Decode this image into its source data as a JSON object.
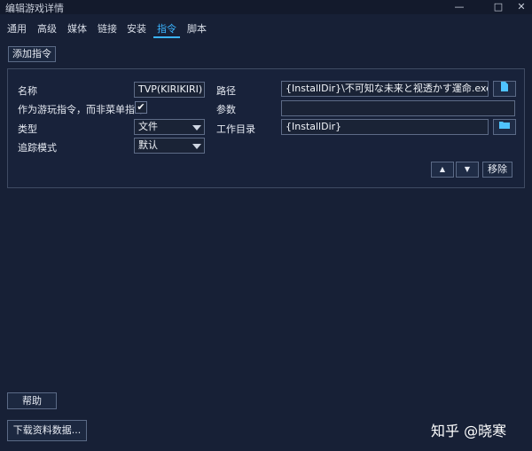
{
  "window": {
    "title": "编辑游戏详情",
    "minimize": "—",
    "maximize": "□",
    "close": "✕"
  },
  "tabs": [
    {
      "label": "通用"
    },
    {
      "label": "高级"
    },
    {
      "label": "媒体"
    },
    {
      "label": "链接"
    },
    {
      "label": "安装"
    },
    {
      "label": "指令"
    },
    {
      "label": "脚本"
    }
  ],
  "active_tab": "指令",
  "toolbar": {
    "add_command": "添加指令"
  },
  "form": {
    "name_label": "名称",
    "name_value": "TVP(KIRIKIRI) Z c",
    "path_label": "路径",
    "path_value": "{InstallDir}\\不可知な未来と视透かす運命.exe",
    "play_action_label": "作为游玩指令，而非菜单指令",
    "play_action_checked": "✔",
    "args_label": "参数",
    "args_value": "",
    "type_label": "类型",
    "type_value": "文件",
    "workdir_label": "工作目录",
    "workdir_value": "{InstallDir}",
    "tracking_label": "追踪模式",
    "tracking_value": "默认"
  },
  "actions": {
    "move_up": "▲",
    "move_down": "▼",
    "remove": "移除"
  },
  "footer": {
    "help": "帮助",
    "download_metadata": "下载资料数据..."
  },
  "icons": {
    "browse_file": "file-icon",
    "browse_folder": "folder-icon"
  },
  "watermark": "知乎 @晓寒"
}
